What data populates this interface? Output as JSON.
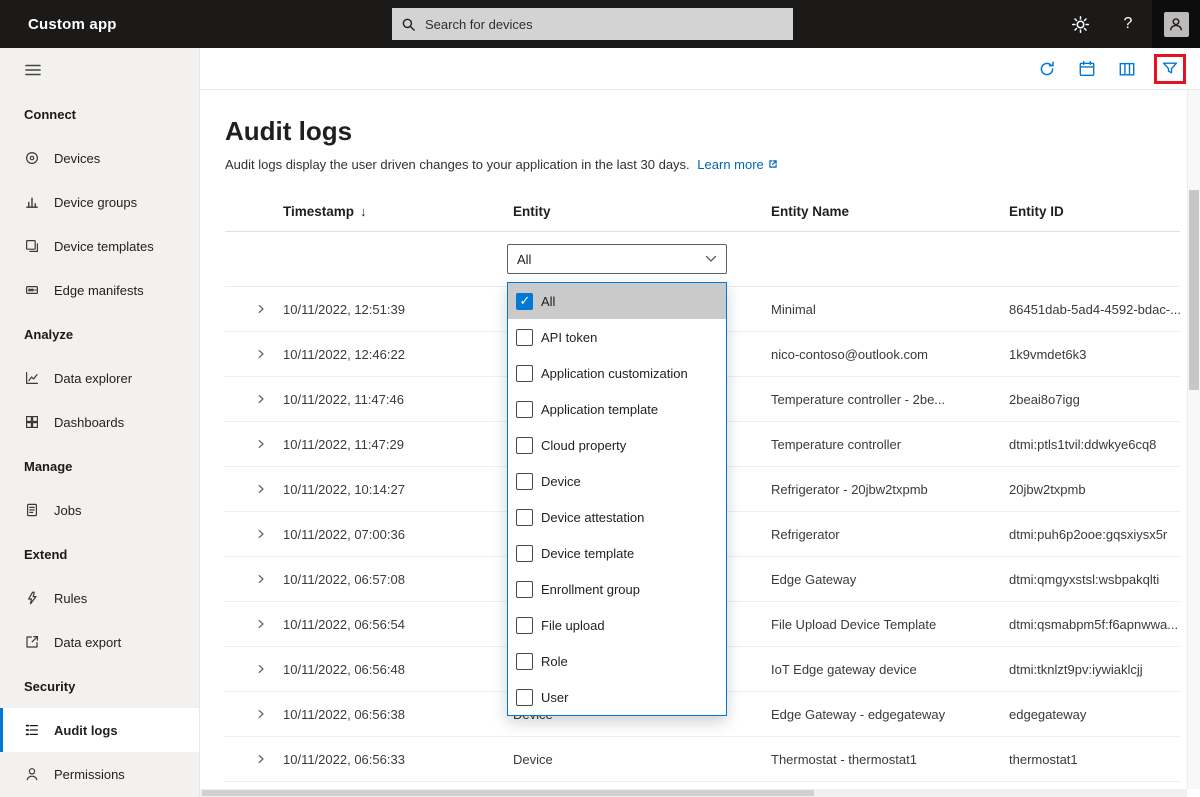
{
  "topbar": {
    "app_title": "Custom app",
    "search_placeholder": "Search for devices",
    "help_label": "?"
  },
  "sidebar": {
    "sections": [
      {
        "label": "Connect",
        "items": [
          {
            "label": "Devices"
          },
          {
            "label": "Device groups"
          },
          {
            "label": "Device templates"
          },
          {
            "label": "Edge manifests"
          }
        ]
      },
      {
        "label": "Analyze",
        "items": [
          {
            "label": "Data explorer"
          },
          {
            "label": "Dashboards"
          }
        ]
      },
      {
        "label": "Manage",
        "items": [
          {
            "label": "Jobs"
          }
        ]
      },
      {
        "label": "Extend",
        "items": [
          {
            "label": "Rules"
          },
          {
            "label": "Data export"
          }
        ]
      },
      {
        "label": "Security",
        "items": [
          {
            "label": "Audit logs",
            "selected": true
          },
          {
            "label": "Permissions"
          }
        ]
      }
    ]
  },
  "page": {
    "title": "Audit logs",
    "description": "Audit logs display the user driven changes to your application in the last 30 days.",
    "learn_more_label": "Learn more"
  },
  "table": {
    "headers": {
      "timestamp": "Timestamp",
      "entity": "Entity",
      "entity_name": "Entity Name",
      "entity_id": "Entity ID"
    },
    "sort_indicator": "↓",
    "rows": [
      {
        "timestamp": "10/11/2022, 12:51:39",
        "entity": "",
        "entity_name": "Minimal",
        "entity_id": "86451dab-5ad4-4592-bdac-..."
      },
      {
        "timestamp": "10/11/2022, 12:46:22",
        "entity": "",
        "entity_name": "nico-contoso@outlook.com",
        "entity_id": "1k9vmdet6k3"
      },
      {
        "timestamp": "10/11/2022, 11:47:46",
        "entity": "",
        "entity_name": "Temperature controller - 2be...",
        "entity_id": "2beai8o7igg"
      },
      {
        "timestamp": "10/11/2022, 11:47:29",
        "entity": "",
        "entity_name": "Temperature controller",
        "entity_id": "dtmi:ptls1tvil:ddwkye6cq8"
      },
      {
        "timestamp": "10/11/2022, 10:14:27",
        "entity": "",
        "entity_name": "Refrigerator - 20jbw2txpmb",
        "entity_id": "20jbw2txpmb"
      },
      {
        "timestamp": "10/11/2022, 07:00:36",
        "entity": "",
        "entity_name": "Refrigerator",
        "entity_id": "dtmi:puh6p2ooe:gqsxiysx5r"
      },
      {
        "timestamp": "10/11/2022, 06:57:08",
        "entity": "",
        "entity_name": "Edge Gateway",
        "entity_id": "dtmi:qmgyxstsl:wsbpakqlti"
      },
      {
        "timestamp": "10/11/2022, 06:56:54",
        "entity": "",
        "entity_name": "File Upload Device Template",
        "entity_id": "dtmi:qsmabpm5f:f6apnwwa..."
      },
      {
        "timestamp": "10/11/2022, 06:56:48",
        "entity": "",
        "entity_name": "IoT Edge gateway device",
        "entity_id": "dtmi:tknlzt9pv:iywiaklcjj"
      },
      {
        "timestamp": "10/11/2022, 06:56:38",
        "entity": "Device",
        "entity_name": "Edge Gateway - edgegateway",
        "entity_id": "edgegateway"
      },
      {
        "timestamp": "10/11/2022, 06:56:33",
        "entity": "Device",
        "entity_name": "Thermostat - thermostat1",
        "entity_id": "thermostat1"
      }
    ]
  },
  "entity_filter": {
    "selected": "All",
    "options": [
      {
        "label": "All",
        "checked": true
      },
      {
        "label": "API token",
        "checked": false
      },
      {
        "label": "Application customization",
        "checked": false
      },
      {
        "label": "Application template",
        "checked": false
      },
      {
        "label": "Cloud property",
        "checked": false
      },
      {
        "label": "Device",
        "checked": false
      },
      {
        "label": "Device attestation",
        "checked": false
      },
      {
        "label": "Device template",
        "checked": false
      },
      {
        "label": "Enrollment group",
        "checked": false
      },
      {
        "label": "File upload",
        "checked": false
      },
      {
        "label": "Role",
        "checked": false
      },
      {
        "label": "User",
        "checked": false
      }
    ]
  },
  "colors": {
    "accent": "#0078d4",
    "link": "#0067b8",
    "annotation_red": "#e81123",
    "topbar_bg": "#1b1a19",
    "sidebar_bg": "#f2f1f0"
  }
}
